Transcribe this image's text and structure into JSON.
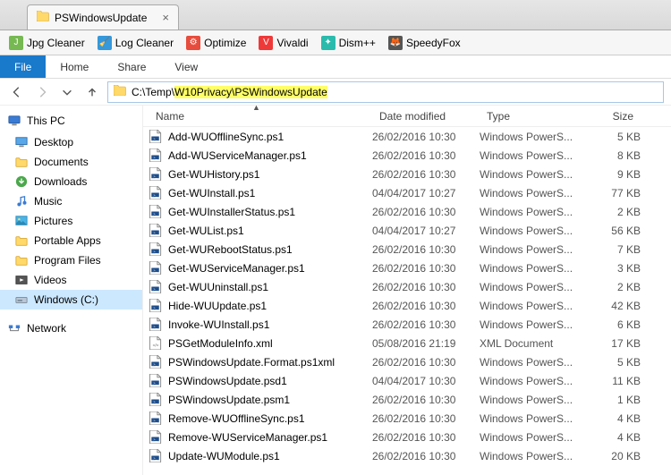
{
  "tab": {
    "title": "PSWindowsUpdate"
  },
  "toolbar_items": [
    {
      "label": "Jpg Cleaner",
      "color": "#76b852",
      "glyph": "J"
    },
    {
      "label": "Log Cleaner",
      "color": "#3498db",
      "glyph": "🧹"
    },
    {
      "label": "Optimize",
      "color": "#e74c3c",
      "glyph": "⚙"
    },
    {
      "label": "Vivaldi",
      "color": "#ef3939",
      "glyph": "V"
    },
    {
      "label": "Dism++",
      "color": "#2bbbad",
      "glyph": "✦"
    },
    {
      "label": "SpeedyFox",
      "color": "#555",
      "glyph": "🦊"
    }
  ],
  "ribbon": {
    "file": "File",
    "home": "Home",
    "share": "Share",
    "view": "View"
  },
  "address": {
    "prefix": "C:\\Temp\\",
    "highlighted": "W10Privacy\\PSWindowsUpdate"
  },
  "columns": {
    "name": "Name",
    "date": "Date modified",
    "type": "Type",
    "size": "Size"
  },
  "sidebar": {
    "thispc": "This PC",
    "items": [
      {
        "label": "Desktop",
        "icon": "desktop"
      },
      {
        "label": "Documents",
        "icon": "folder"
      },
      {
        "label": "Downloads",
        "icon": "downloads"
      },
      {
        "label": "Music",
        "icon": "music"
      },
      {
        "label": "Pictures",
        "icon": "pictures"
      },
      {
        "label": "Portable Apps",
        "icon": "folder"
      },
      {
        "label": "Program Files",
        "icon": "folder"
      },
      {
        "label": "Videos",
        "icon": "videos"
      },
      {
        "label": "Windows (C:)",
        "icon": "drive",
        "selected": true
      }
    ],
    "network": "Network"
  },
  "files": [
    {
      "name": "Add-WUOfflineSync.ps1",
      "date": "26/02/2016 10:30",
      "type": "Windows PowerS...",
      "size": "5 KB",
      "icon": "ps1"
    },
    {
      "name": "Add-WUServiceManager.ps1",
      "date": "26/02/2016 10:30",
      "type": "Windows PowerS...",
      "size": "8 KB",
      "icon": "ps1"
    },
    {
      "name": "Get-WUHistory.ps1",
      "date": "26/02/2016 10:30",
      "type": "Windows PowerS...",
      "size": "9 KB",
      "icon": "ps1"
    },
    {
      "name": "Get-WUInstall.ps1",
      "date": "04/04/2017 10:27",
      "type": "Windows PowerS...",
      "size": "77 KB",
      "icon": "ps1"
    },
    {
      "name": "Get-WUInstallerStatus.ps1",
      "date": "26/02/2016 10:30",
      "type": "Windows PowerS...",
      "size": "2 KB",
      "icon": "ps1"
    },
    {
      "name": "Get-WUList.ps1",
      "date": "04/04/2017 10:27",
      "type": "Windows PowerS...",
      "size": "56 KB",
      "icon": "ps1"
    },
    {
      "name": "Get-WURebootStatus.ps1",
      "date": "26/02/2016 10:30",
      "type": "Windows PowerS...",
      "size": "7 KB",
      "icon": "ps1"
    },
    {
      "name": "Get-WUServiceManager.ps1",
      "date": "26/02/2016 10:30",
      "type": "Windows PowerS...",
      "size": "3 KB",
      "icon": "ps1"
    },
    {
      "name": "Get-WUUninstall.ps1",
      "date": "26/02/2016 10:30",
      "type": "Windows PowerS...",
      "size": "2 KB",
      "icon": "ps1"
    },
    {
      "name": "Hide-WUUpdate.ps1",
      "date": "26/02/2016 10:30",
      "type": "Windows PowerS...",
      "size": "42 KB",
      "icon": "ps1"
    },
    {
      "name": "Invoke-WUInstall.ps1",
      "date": "26/02/2016 10:30",
      "type": "Windows PowerS...",
      "size": "6 KB",
      "icon": "ps1"
    },
    {
      "name": "PSGetModuleInfo.xml",
      "date": "05/08/2016 21:19",
      "type": "XML Document",
      "size": "17 KB",
      "icon": "xml"
    },
    {
      "name": "PSWindowsUpdate.Format.ps1xml",
      "date": "26/02/2016 10:30",
      "type": "Windows PowerS...",
      "size": "5 KB",
      "icon": "ps1"
    },
    {
      "name": "PSWindowsUpdate.psd1",
      "date": "04/04/2017 10:30",
      "type": "Windows PowerS...",
      "size": "11 KB",
      "icon": "ps1"
    },
    {
      "name": "PSWindowsUpdate.psm1",
      "date": "26/02/2016 10:30",
      "type": "Windows PowerS...",
      "size": "1 KB",
      "icon": "ps1"
    },
    {
      "name": "Remove-WUOfflineSync.ps1",
      "date": "26/02/2016 10:30",
      "type": "Windows PowerS...",
      "size": "4 KB",
      "icon": "ps1"
    },
    {
      "name": "Remove-WUServiceManager.ps1",
      "date": "26/02/2016 10:30",
      "type": "Windows PowerS...",
      "size": "4 KB",
      "icon": "ps1"
    },
    {
      "name": "Update-WUModule.ps1",
      "date": "26/02/2016 10:30",
      "type": "Windows PowerS...",
      "size": "20 KB",
      "icon": "ps1"
    }
  ]
}
